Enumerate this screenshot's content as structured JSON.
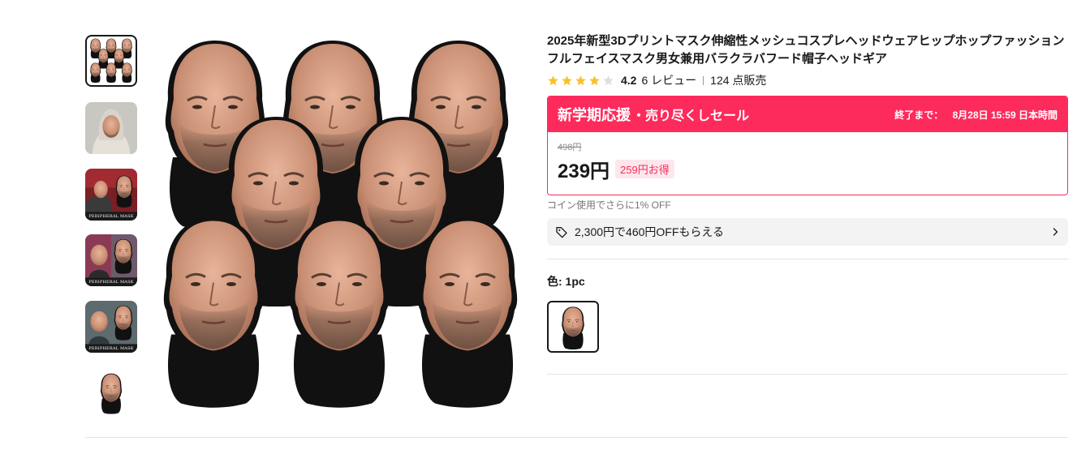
{
  "product": {
    "title": "2025年新型3Dプリントマスク伸縮性メッシュコスプレヘッドウェアヒップホップファッションフルフェイスマスク男女兼用バラクラバフード帽子ヘッドギア",
    "rating": "4.2",
    "reviews": "6 レビュー",
    "sold": "124 点販売"
  },
  "thumbnails": [
    {
      "caption": ""
    },
    {
      "caption": ""
    },
    {
      "caption": "PERIPHERAL MASK"
    },
    {
      "caption": "PERIPHERAL MASK"
    },
    {
      "caption": "PERIPHERAL MASK"
    },
    {
      "caption": ""
    }
  ],
  "sale": {
    "name": "新学期応援",
    "sub": "・売り尽くしセール",
    "end_label": "終了まで：",
    "end_time": "8月28日 15:59 日本時間",
    "original_price": "498円",
    "price": "239円",
    "savings": "259円お得",
    "accent_color": "#fd2b5c"
  },
  "coin_note": "コイン使用でさらに1% OFF",
  "coupon": {
    "text": "2,300円で460円OFFもらえる",
    "icon": "tag-icon"
  },
  "color": {
    "label": "色: 1pc"
  }
}
